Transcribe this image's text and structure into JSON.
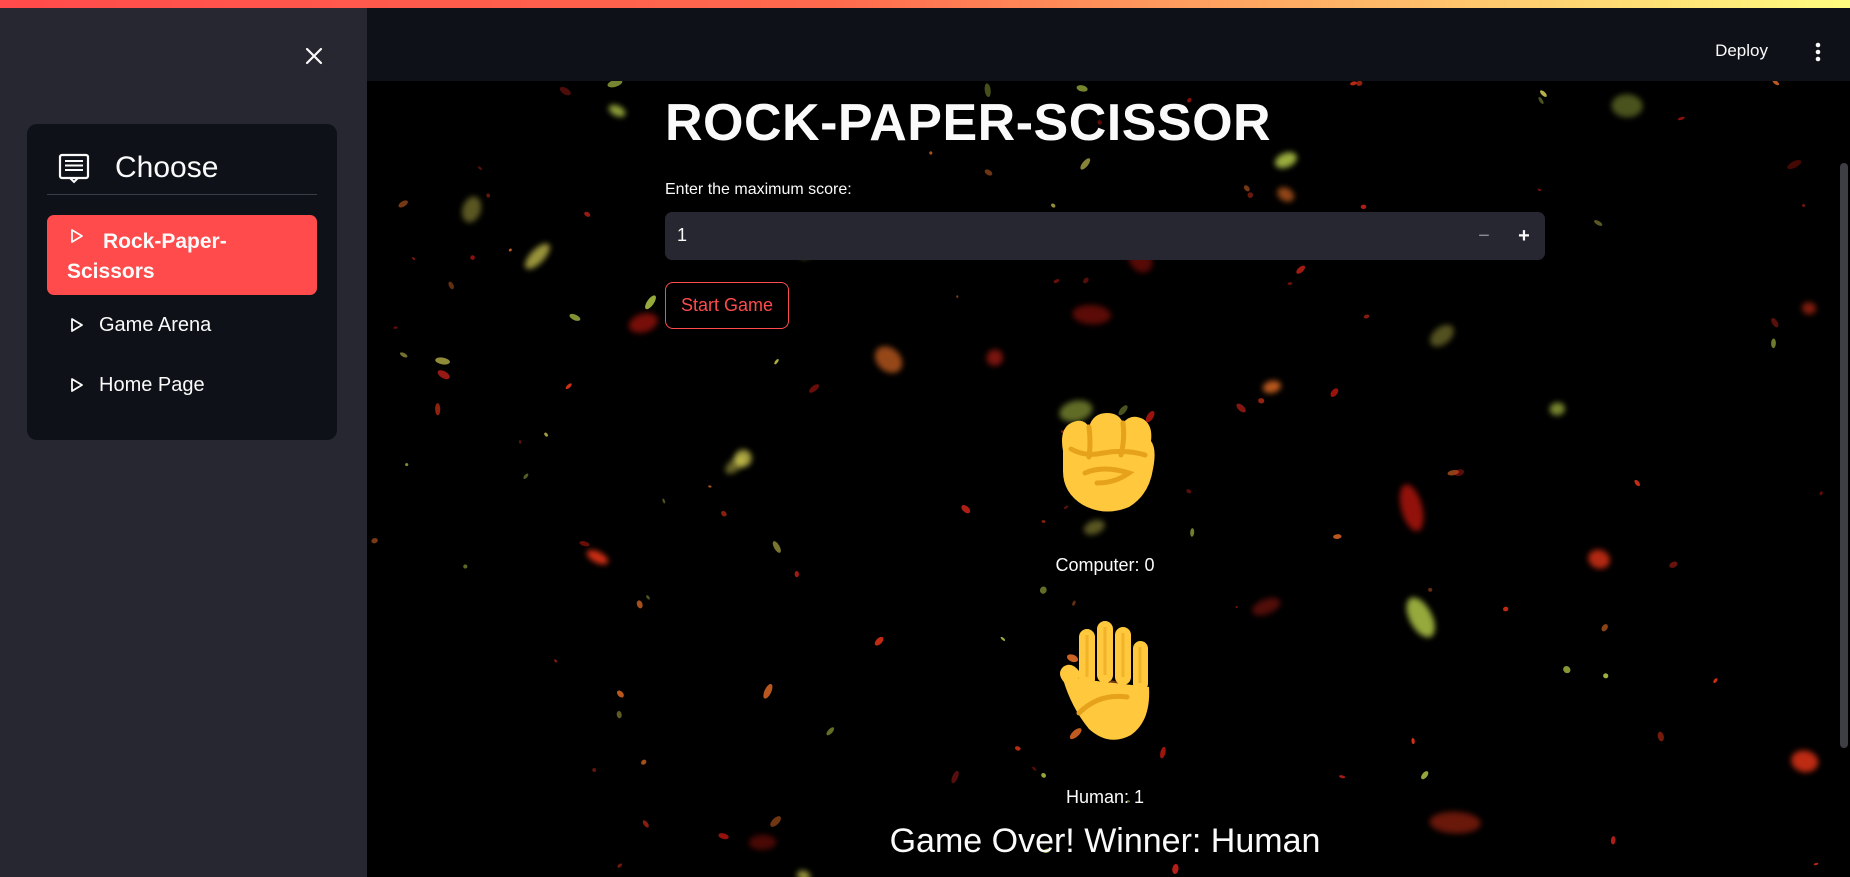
{
  "sidebar": {
    "nav_title": "Choose",
    "icons": {
      "close": "close-icon",
      "header": "document-list-icon",
      "item": "triangle-right-icon"
    },
    "items": [
      {
        "label": "Rock-Paper-Scissors",
        "active": true
      },
      {
        "label": "Game Arena",
        "active": false
      },
      {
        "label": "Home Page",
        "active": false
      }
    ]
  },
  "header": {
    "deploy_label": "Deploy",
    "menu_icon": "vertical-dots-icon"
  },
  "main": {
    "title": "ROCK-PAPER-SCISSOR",
    "score_label": "Enter the maximum score:",
    "score_value": "1",
    "minus": "−",
    "plus": "+",
    "start_button": "Start Game",
    "computer_hand": "raised-fist",
    "computer_score": "Computer: 0",
    "human_hand": "raised-hand",
    "human_score": "Human: 1",
    "result": "Game Over! Winner: Human"
  },
  "colors": {
    "accent": "#ff4b4b",
    "sidebar_bg": "#262730",
    "card_bg": "#0e1117",
    "input_bg": "#262730",
    "hand_yellow": "#ffc83d",
    "hand_shadow": "#e6a21a"
  }
}
